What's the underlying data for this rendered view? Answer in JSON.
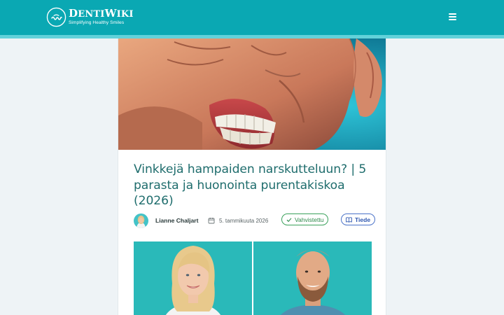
{
  "header": {
    "logo_name_first": "D",
    "logo_name_rest1": "ENTI",
    "logo_name_second": "W",
    "logo_name_rest2": "IKI",
    "logo_tagline": "Simplifying Healthy Smiles",
    "logo_mark_text": "DENTIWIKI",
    "menu_icon": "hamburger-menu-icon",
    "colors": {
      "bar": "#0aa8b3",
      "stripe": "#62d2da"
    }
  },
  "article": {
    "title": "Vinkkejä hampaiden narskutteluun? | 5 parasta ja huonointa purentakiskoa (2026)",
    "author": "Lianne Chaljart",
    "date": "5. tammikuuta 2026",
    "calendar_icon": "calendar-icon",
    "badges": [
      {
        "label": "Vahvistettu",
        "icon": "checkmark-icon",
        "color": "#2d8a4a"
      },
      {
        "label": "Tiede",
        "icon": "book-icon",
        "color": "#2e57b0"
      }
    ],
    "title_color": "#1f6d6d"
  }
}
